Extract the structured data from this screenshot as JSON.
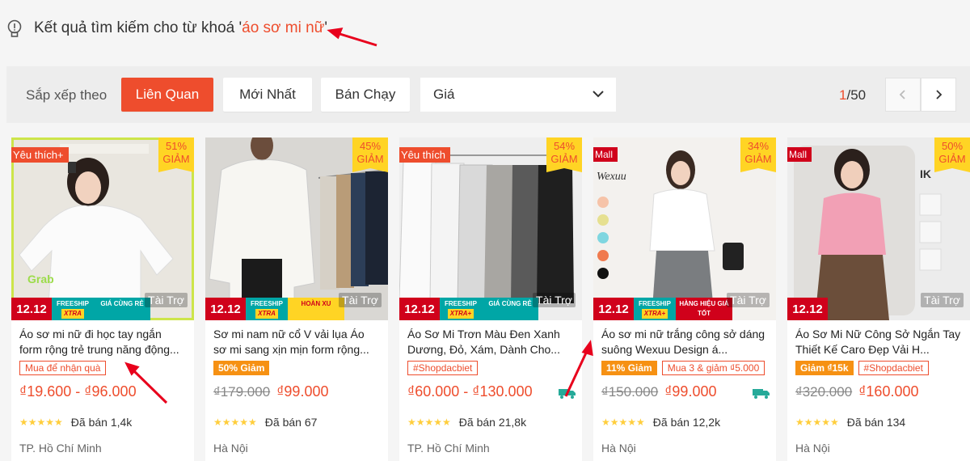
{
  "search": {
    "prefix": "Kết quả tìm kiếm cho từ khoá '",
    "keyword": "áo sơ mi nữ",
    "suffix": "'"
  },
  "sort": {
    "label": "Sắp xếp theo",
    "options": [
      "Liên Quan",
      "Mới Nhất",
      "Bán Chạy"
    ],
    "active": "Liên Quan",
    "price_label": "Giá"
  },
  "pagination": {
    "current": "1",
    "total": "/50"
  },
  "products": [
    {
      "tag": "Yêu thích+",
      "discount_pct": "51%",
      "discount_word": "GIẢM",
      "sale": "12.12",
      "sponsored": "Tài Trợ",
      "title": "Áo sơ mi nữ đi học tay ngắn form rộng trẻ trung năng động...",
      "promos": [
        {
          "text": "Mua để nhận quà",
          "style": "outline"
        }
      ],
      "old_price": "",
      "price": "₫19.600 - ₫96.000",
      "sold": "Đã bán 1,4k",
      "rating": "5",
      "location": "TP. Hồ Chí Minh"
    },
    {
      "tag": "",
      "discount_pct": "45%",
      "discount_word": "GIẢM",
      "sale": "12.12",
      "sponsored": "Tài Trợ",
      "title": "Sơ mi nam nữ cổ V vải lụa Áo sơ mi sang xịn mịn form rộng...",
      "promos": [
        {
          "text": "50% Giảm",
          "style": "fill"
        }
      ],
      "old_price": "₫179.000",
      "price": "₫99.000",
      "sold": "Đã bán 67",
      "rating": "4.5",
      "location": "Hà Nội"
    },
    {
      "tag": "Yêu thích",
      "discount_pct": "54%",
      "discount_word": "GIẢM",
      "sale": "12.12",
      "sponsored": "Tài Trợ",
      "title": "Áo Sơ Mi Trơn Màu Đen Xanh Dương, Đỏ, Xám, Dành Cho...",
      "promos": [
        {
          "text": "#Shopdacbiet",
          "style": "outline"
        }
      ],
      "old_price": "",
      "price": "₫60.000 - ₫130.000",
      "sold": "Đã bán 21,8k",
      "rating": "5",
      "location": "TP. Hồ Chí Minh"
    },
    {
      "tag": "Mall",
      "discount_pct": "34%",
      "discount_word": "GIẢM",
      "sale": "12.12",
      "sponsored": "Tài Trợ",
      "title": "Áo sơ mi nữ trắng công sở dáng suông Wexuu Design á...",
      "promos": [
        {
          "text": "11% Giảm",
          "style": "fill"
        },
        {
          "text": "Mua 3 & giảm ₫5.000",
          "style": "outline"
        }
      ],
      "old_price": "₫150.000",
      "price": "₫99.000",
      "sold": "Đã bán 12,2k",
      "rating": "5",
      "location": "Hà Nội"
    },
    {
      "tag": "Mall",
      "discount_pct": "50%",
      "discount_word": "GIẢM",
      "sale": "12.12",
      "sponsored": "Tài Trợ",
      "title": "Áo Sơ Mi Nữ Công Sở Ngắn Tay Thiết Kế Caro Đẹp Vải H...",
      "promos": [
        {
          "text": "Giảm ₫15k",
          "style": "fill"
        },
        {
          "text": "#Shopdacbiet",
          "style": "outline"
        }
      ],
      "old_price": "₫320.000",
      "price": "₫160.000",
      "sold": "Đã bán 134",
      "rating": "5",
      "location": "Hà Nội"
    }
  ],
  "badges": {
    "freeship_top": "FREESHIP",
    "freeship_bottom": "XTRA",
    "freeship_plus": "XTRA+",
    "gia_cung_re": "GIÁ CÙNG RẺ",
    "hoan_xu": "HOÀN XU",
    "hang_hieu": "HÀNG HIỆU GIÁ TỐT",
    "free": "Free"
  },
  "colors": {
    "accent": "#ee4d2d",
    "mall": "#d0011b",
    "discount_bg": "#ffd424"
  }
}
